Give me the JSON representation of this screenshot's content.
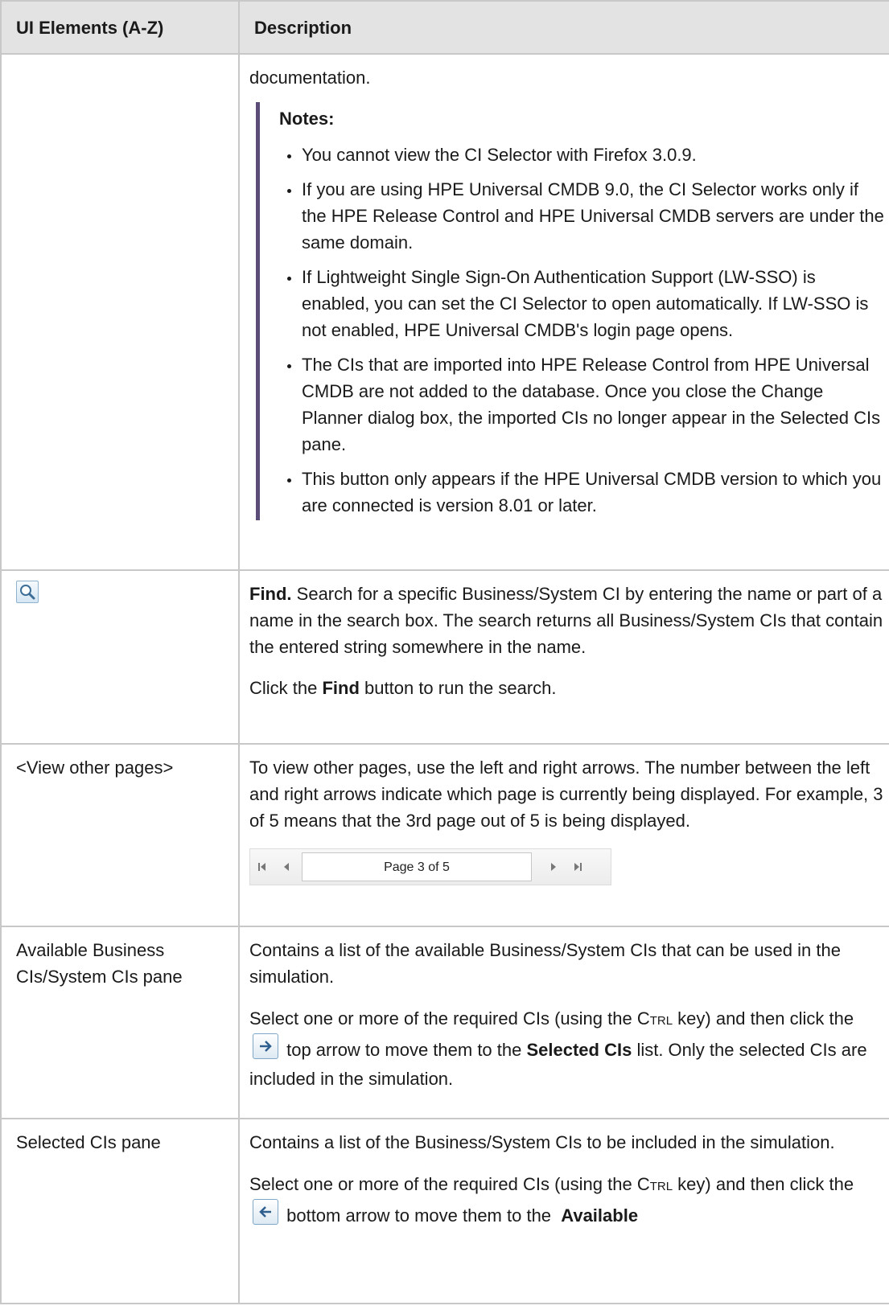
{
  "table": {
    "header_col1": "UI Elements (A-Z)",
    "header_col2": "Description"
  },
  "row_continuation": {
    "text": "documentation.",
    "notes_title": "Notes:",
    "notes": [
      "You cannot view the CI Selector with Firefox 3.0.9.",
      "If you are using HPE Universal CMDB 9.0, the CI Selector works only if the HPE Release Control and HPE Universal CMDB servers are under the same domain.",
      "If Lightweight Single Sign-On Authentication Support (LW-SSO) is enabled, you can set the CI Selector to open automatically. If LW-SSO is not enabled, HPE Universal CMDB's login page opens.",
      "The CIs that are imported into HPE Release Control from HPE Universal CMDB are not added to the database. Once you close the Change Planner dialog box, the imported CIs no longer appear in the Selected CIs pane.",
      "This button only appears if the HPE Universal CMDB version to which you are connected is version 8.01 or later."
    ]
  },
  "row_find": {
    "icon": "magnifier-icon",
    "title": "Find.",
    "desc": " Search for a specific Business/System CI by entering the name or part of a name in the search box. The search returns all Business/System CIs that contain the entered string somewhere in the name.",
    "click_pre": "Click the ",
    "click_bold": "Find",
    "click_post": " button to run the search."
  },
  "row_pages": {
    "element": "<View other pages>",
    "desc": "To view other pages, use the left and right arrows. The number between the left and right arrows indicate which page is currently being displayed. For example, 3 of 5 means that the 3rd page out of 5 is being displayed.",
    "pager_text": "Page 3 of 5"
  },
  "row_available": {
    "element": "Available Business CIs/System CIs pane",
    "desc": "Contains a list of the available Business/System CIs that can be used in the simulation.",
    "select_pre": "Select one or more of the required CIs (using the ",
    "key_c": "C",
    "key_rest": "TRL",
    "select_mid": " key) and then click the ",
    "select_post": " top arrow to move them to the ",
    "select_bold": "Selected CIs",
    "select_end": " list. Only the selected CIs are included in the simulation."
  },
  "row_selected": {
    "element": "Selected CIs pane",
    "desc": "Contains a list of the Business/System CIs to be included in the simulation.",
    "select_pre": "Select one or more of the required CIs (using the ",
    "key_c": "C",
    "key_rest": "TRL",
    "select_mid": " key) and then click the ",
    "select_post": " bottom arrow to move them to the  ",
    "select_bold": "Available"
  }
}
